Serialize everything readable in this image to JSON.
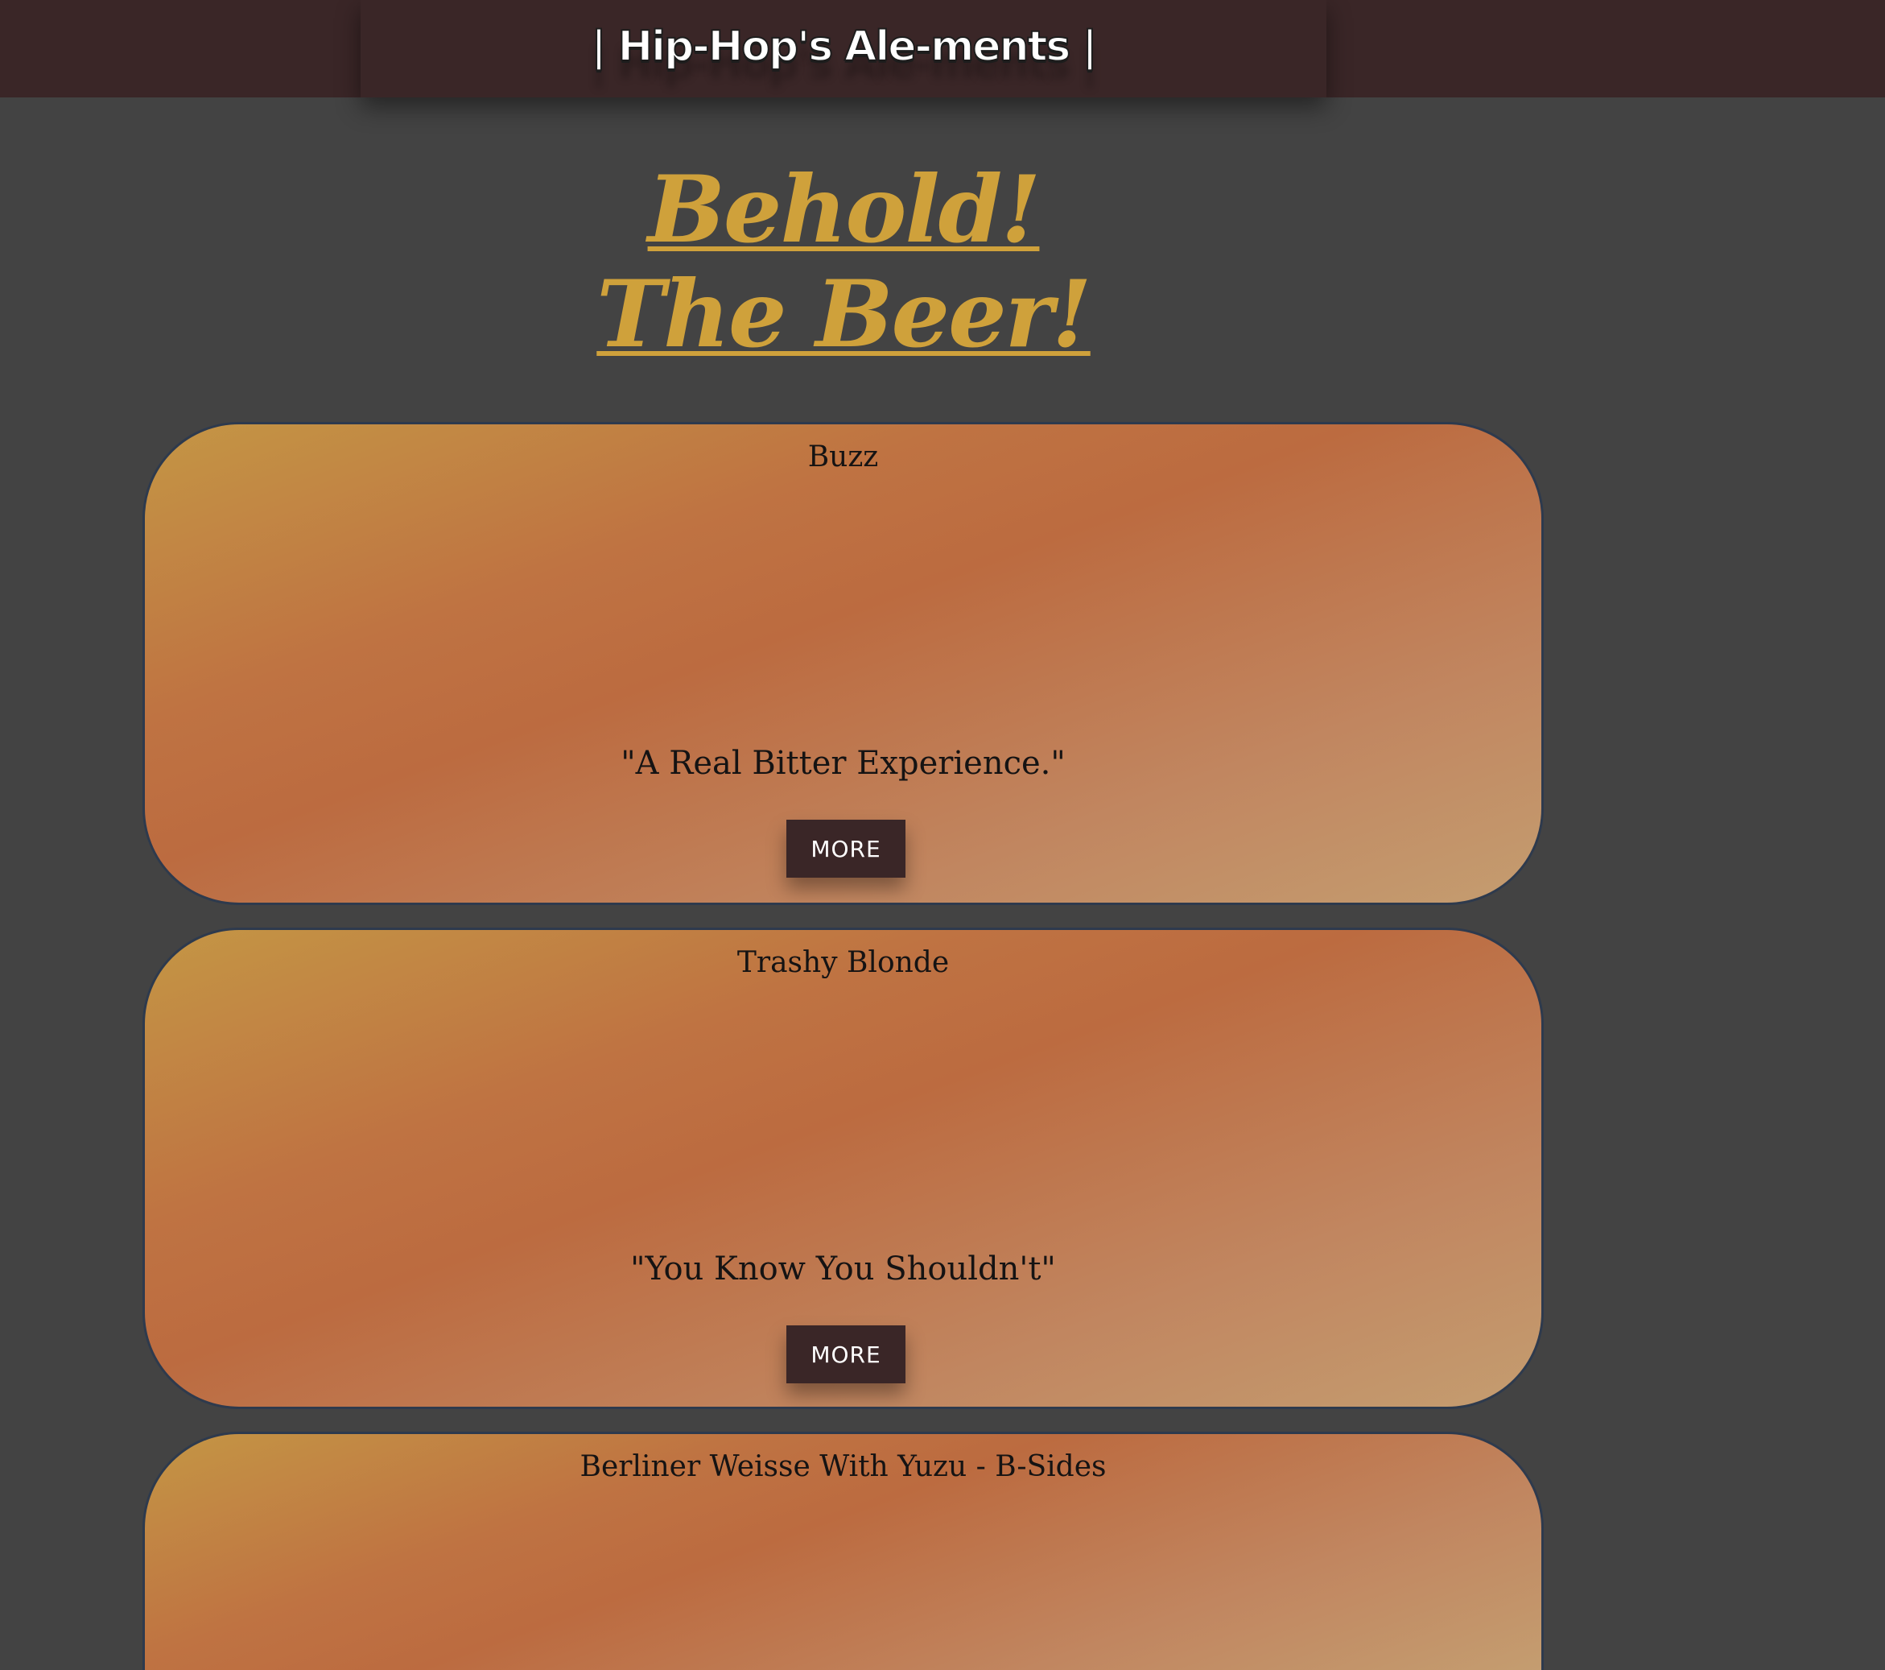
{
  "header": {
    "brand": "| Hip-Hop's Ale-ments |"
  },
  "heading": {
    "line1": "Behold!",
    "line2": "The Beer!"
  },
  "beers": [
    {
      "name": "Buzz",
      "tagline": "\"A Real Bitter Experience.\"",
      "button_label": "MORE"
    },
    {
      "name": "Trashy Blonde",
      "tagline": "\"You Know You Shouldn't\"",
      "button_label": "MORE"
    },
    {
      "name": "Berliner Weisse With Yuzu - B-Sides"
    }
  ],
  "colors": {
    "background": "#434343",
    "header": "#3a2627",
    "heading": "#cfa13b",
    "button": "#3a2627"
  }
}
